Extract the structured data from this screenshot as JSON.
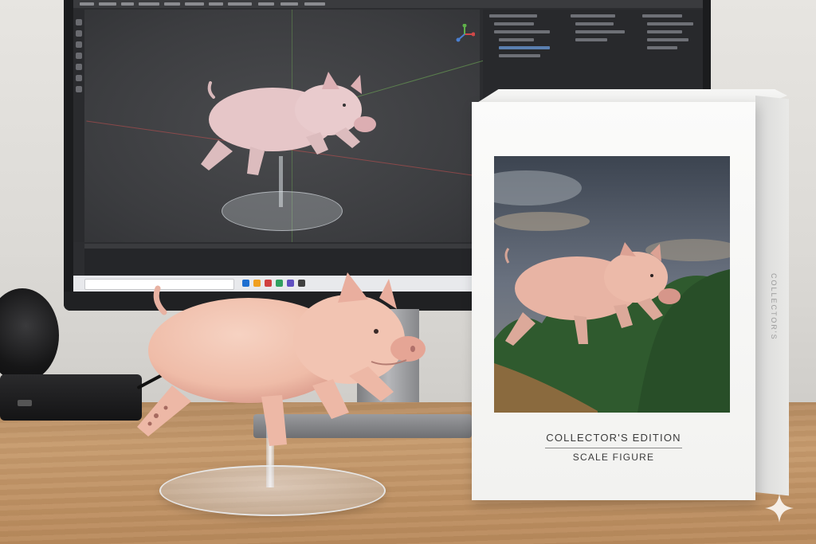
{
  "scene": "desk-photo",
  "box": {
    "title": "COLLECTOR'S EDITION",
    "subtitle": "SCALE FIGURE",
    "side_text": "COLLECTOR'S"
  },
  "colors": {
    "pig_skin": "#f2c2b0",
    "pig_shade": "#d99a8a",
    "screen_pig": "#e6c6c8",
    "desk": "#c79b6d",
    "sky": "#5a6370",
    "trees": "#2f5a2e"
  },
  "icons": [
    "sparkle-icon",
    "gizmo-icon"
  ]
}
